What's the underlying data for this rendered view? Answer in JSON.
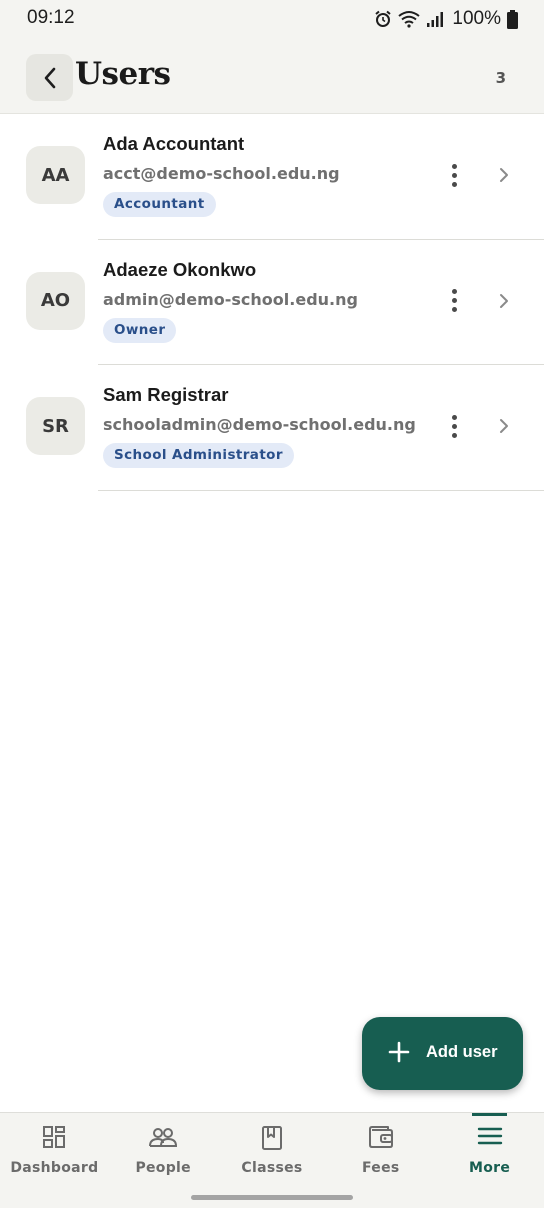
{
  "status_bar": {
    "time": "09:12",
    "battery": "100%",
    "icons": [
      "alarm-icon",
      "wifi-icon",
      "signal-icon",
      "battery-icon"
    ]
  },
  "app_bar": {
    "title": "Users",
    "count": "3",
    "back_icon": "chevron-left-icon"
  },
  "users": [
    {
      "initials": "AA",
      "name": "Ada Accountant",
      "email": "acct@demo-school.edu.ng",
      "role": "Accountant"
    },
    {
      "initials": "AO",
      "name": "Adaeze Okonkwo",
      "email": "admin@demo-school.edu.ng",
      "role": "Owner"
    },
    {
      "initials": "SR",
      "name": "Sam Registrar",
      "email": "schooladmin@demo-school.edu.ng",
      "role": "School Administrator"
    }
  ],
  "fab": {
    "label": "Add user",
    "icon": "plus-icon"
  },
  "bottom_nav": {
    "items": [
      {
        "label": "Dashboard",
        "icon": "dashboard-icon"
      },
      {
        "label": "People",
        "icon": "people-icon"
      },
      {
        "label": "Classes",
        "icon": "book-icon"
      },
      {
        "label": "Fees",
        "icon": "wallet-icon"
      },
      {
        "label": "More",
        "icon": "menu-icon"
      }
    ],
    "active": "More"
  },
  "colors": {
    "primary": "#175e51",
    "badge_bg": "#e3eaf7",
    "badge_text": "#2a4f8a",
    "surface": "#f4f4f1"
  }
}
